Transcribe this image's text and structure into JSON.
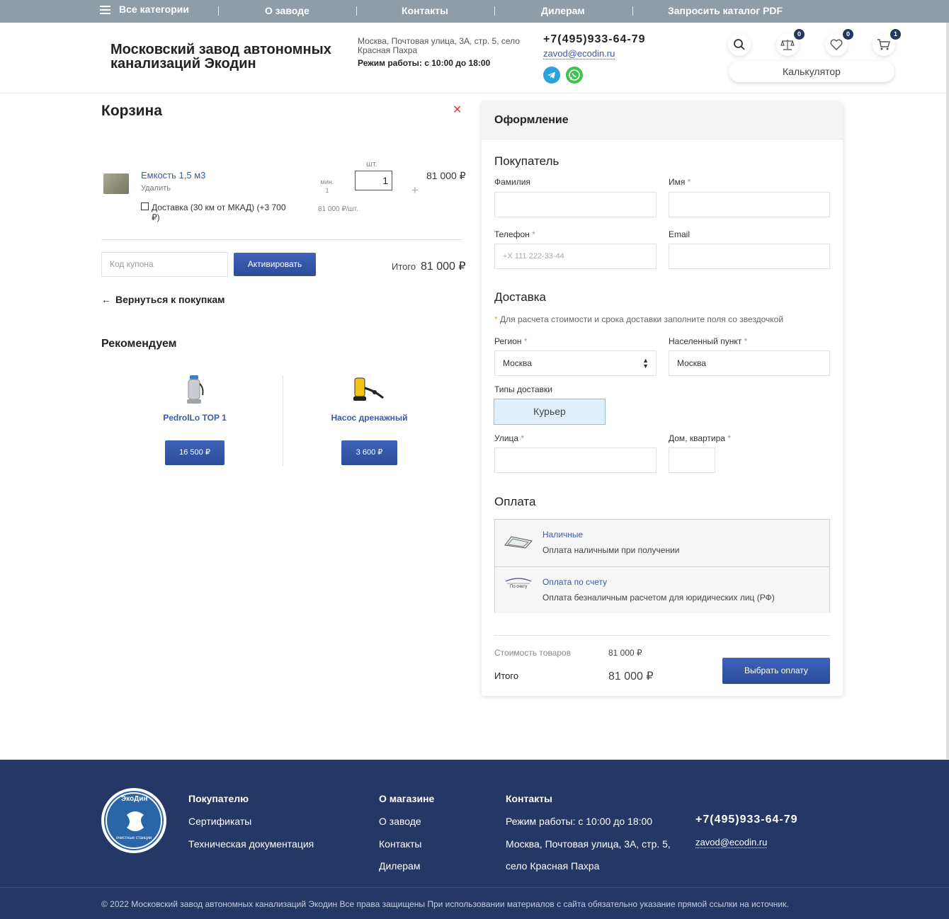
{
  "topnav": {
    "all_categories": "Все категории",
    "items": [
      "О заводе",
      "Контакты",
      "Дилерам",
      "Запросить каталог PDF"
    ]
  },
  "header": {
    "company": "Московский завод автономных канализаций Экодин",
    "address": "Москва, Почтовая улица, 3А, стр. 5, село Красная Пахра",
    "hours": "Режим работы: с 10:00 до 18:00",
    "phone": "+7(495)933-64-79",
    "email": "zavod@ecodin.ru",
    "compare_count": "0",
    "favorites_count": "0",
    "cart_count": "1",
    "calculator": "Калькулятор"
  },
  "cart": {
    "title": "Корзина",
    "item": {
      "name": "Емкость 1,5 м3",
      "remove": "Удалить",
      "delivery_option": "Доставка (30 км от МКАД) (+3 700 ₽)",
      "min_label": "мин.",
      "min_value": "1",
      "unit": "шт.",
      "qty": "1",
      "per_unit": "81 000 ₽/шт.",
      "price": "81 000 ₽"
    },
    "coupon_placeholder": "Код купона",
    "activate": "Активировать",
    "total_label": "Итого",
    "total_value": "81 000 ₽",
    "back": "Вернуться к покупкам"
  },
  "recommend": {
    "title": "Рекомендуем",
    "items": [
      {
        "name": "PedrolLo TOP 1",
        "price": "16 500 ₽"
      },
      {
        "name": "Насос дренажный",
        "price": "3 600 ₽"
      }
    ]
  },
  "checkout": {
    "title": "Оформление",
    "buyer_section": "Покупатель",
    "surname_label": "Фамилия",
    "name_label": "Имя",
    "phone_label": "Телефон",
    "phone_placeholder": "+X 111 222-33-44",
    "email_label": "Email",
    "delivery_section": "Доставка",
    "delivery_note": "Для расчета стоимости и срока доставки заполните поля со звездочкой",
    "region_label": "Регион",
    "region_value": "Москва",
    "city_label": "Населенный пункт",
    "city_value": "Москва",
    "delivery_types_label": "Типы доставки",
    "courier": "Курьер",
    "street_label": "Улица",
    "house_label": "Дом, квартира",
    "payment_section": "Оплата",
    "payments": [
      {
        "name": "Наличные",
        "desc": "Оплата наличными при получении"
      },
      {
        "name": "Оплата по счету",
        "desc": "Оплата безналичным расчетом для юридических лиц (РФ)",
        "icon_caption": "По счету"
      }
    ],
    "goods_cost_label": "Стоимость товаров",
    "goods_cost_value": "81 000 ₽",
    "total_label": "Итого",
    "total_value": "81 000 ₽",
    "submit": "Выбрать оплату"
  },
  "footer": {
    "logo_text": "ЭкоДин",
    "logo_caption": "очистные станции",
    "buyer_title": "Покупателю",
    "buyer_links": [
      "Сертификаты",
      "Техническая документация"
    ],
    "store_title": "О магазине",
    "store_links": [
      "О заводе",
      "Контакты",
      "Дилерам"
    ],
    "contacts_title": "Контакты",
    "contacts_lines": [
      "Режим работы: с 10:00 до 18:00",
      "Москва, Почтовая улица, 3А, стр. 5,",
      "село Красная Пахра"
    ],
    "phone": "+7(495)933-64-79",
    "email": "zavod@ecodin.ru",
    "copyright": "© 2022  Московский завод автономных канализаций Экодин  Все права защищены  При использовании материалов с сайта обязательно указание прямой ссылки на источник."
  },
  "colors": {
    "accent": "#3a5ba9",
    "topnav_bg": "#8d9ea8",
    "footer_bg": "#243765",
    "badge_bg": "#26375e"
  }
}
